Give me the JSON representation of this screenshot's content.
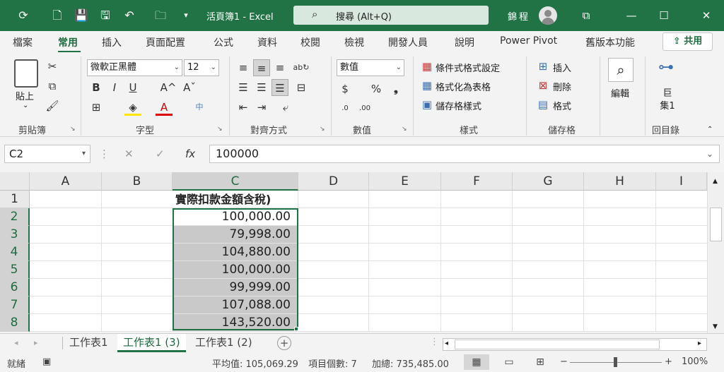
{
  "title_bar": {
    "doc_title": "活頁簿1  -  Excel",
    "search_placeholder": "搜尋 (Alt+Q)",
    "user_name": "錦程",
    "minimize": "—",
    "restore": "☐",
    "close": "✕",
    "ribbon_display": "⧉"
  },
  "tabs": [
    "檔案",
    "常用",
    "插入",
    "頁面配置",
    "公式",
    "資料",
    "校閱",
    "檢視",
    "開發人員",
    "說明",
    "Power Pivot",
    "舊版本功能"
  ],
  "active_tab": "常用",
  "share_label": "共用",
  "ribbon": {
    "clipboard": {
      "paste": "貼上",
      "label": "剪貼簿"
    },
    "font": {
      "name": "微軟正黑體",
      "size": "12",
      "bold": "B",
      "italic": "I",
      "underline": "U",
      "grow": "A^",
      "shrink": "Aˇ",
      "label": "字型"
    },
    "alignment": {
      "label": "對齊方式"
    },
    "number": {
      "format": "數值",
      "label": "數值"
    },
    "styles": {
      "conditional": "條件式格式設定",
      "table": "格式化為表格",
      "cell": "儲存格樣式",
      "label": "樣式"
    },
    "cells": {
      "insert": "插入",
      "delete": "刪除",
      "format": "格式",
      "label": "儲存格"
    },
    "editing": {
      "edit": "編輯",
      "label": ""
    },
    "macro": {
      "macro": "巨集1",
      "label": "回目錄"
    }
  },
  "formula_bar": {
    "name_box": "C2",
    "value": "100000"
  },
  "columns": [
    "A",
    "B",
    "C",
    "D",
    "E",
    "F",
    "G",
    "H",
    "I"
  ],
  "rows": [
    "1",
    "2",
    "3",
    "4",
    "5",
    "6",
    "7",
    "8"
  ],
  "cells": {
    "c1": "實際扣款金額含稅)",
    "c_values": [
      "100,000.00",
      "79,998.00",
      "104,880.00",
      "100,000.00",
      "99,999.00",
      "107,088.00",
      "143,520.00"
    ]
  },
  "sheet_tabs": [
    "工作表1",
    "工作表1 (3)",
    "工作表1 (2)"
  ],
  "active_sheet": "工作表1 (3)",
  "status": {
    "ready": "就緒",
    "average": "平均值: 105,069.29",
    "count": "項目個數: 7",
    "sum": "加總: 735,485.00",
    "zoom": "100%"
  },
  "colors": {
    "accent": "#217346",
    "selection_fill": "#c9c9c9"
  }
}
